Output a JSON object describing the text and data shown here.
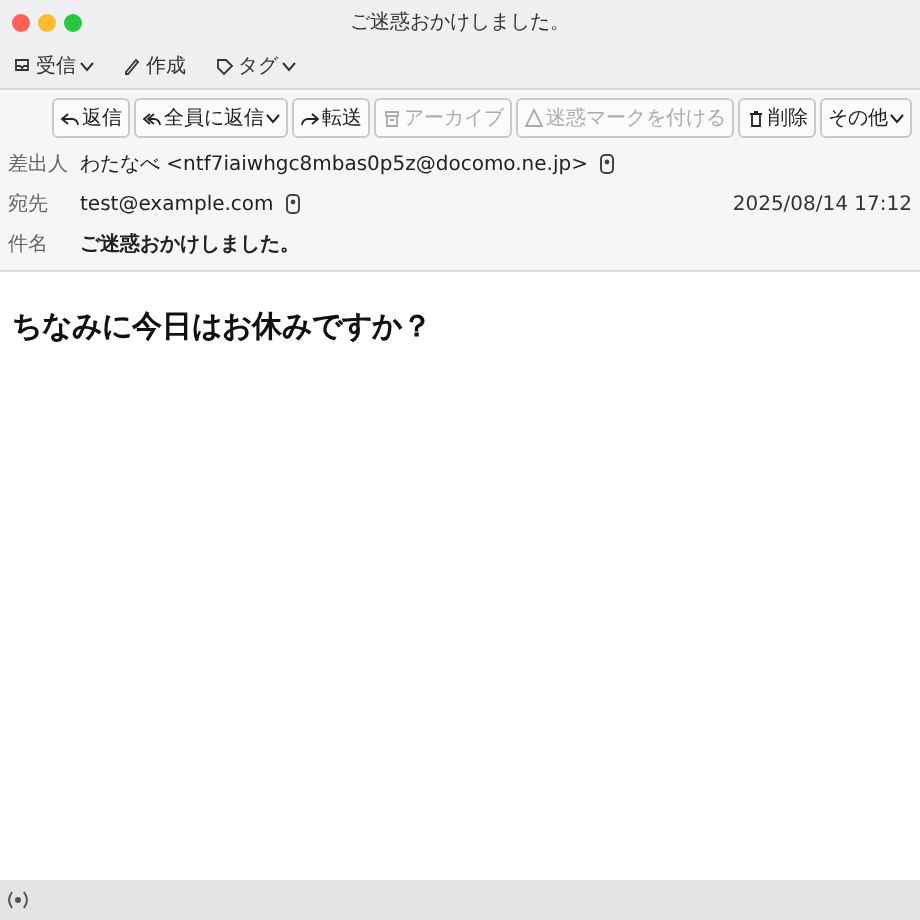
{
  "window": {
    "title": "ご迷惑おかけしました。"
  },
  "toolbar": [
    {
      "label": "受信",
      "kind": "inbox",
      "menu": true
    },
    {
      "label": "作成",
      "kind": "compose",
      "menu": false
    },
    {
      "label": "タグ",
      "kind": "tag",
      "menu": true
    }
  ],
  "actions": [
    {
      "label": "返信",
      "kind": "reply",
      "menu": false,
      "disabled": false
    },
    {
      "label": "全員に返信",
      "kind": "reply-all",
      "menu": true,
      "disabled": false
    },
    {
      "label": "転送",
      "kind": "forward",
      "menu": false,
      "disabled": false
    },
    {
      "label": "アーカイブ",
      "kind": "archive",
      "menu": false,
      "disabled": true
    },
    {
      "label": "迷惑マークを付ける",
      "kind": "junk",
      "menu": false,
      "disabled": true
    },
    {
      "label": "削除",
      "kind": "delete",
      "menu": false,
      "disabled": false
    },
    {
      "label": "その他",
      "kind": "more",
      "menu": true,
      "disabled": false
    }
  ],
  "header": {
    "from_label": "差出人",
    "from": "わたなべ <ntf7iaiwhgc8mbas0p5z@docomo.ne.jp>",
    "to_label": "宛先",
    "to": "test@example.com",
    "date": "2025/08/14 17:12",
    "subject_label": "件名",
    "subject": "ご迷惑おかけしました。"
  },
  "body": "ちなみに今日はお休みですか？"
}
